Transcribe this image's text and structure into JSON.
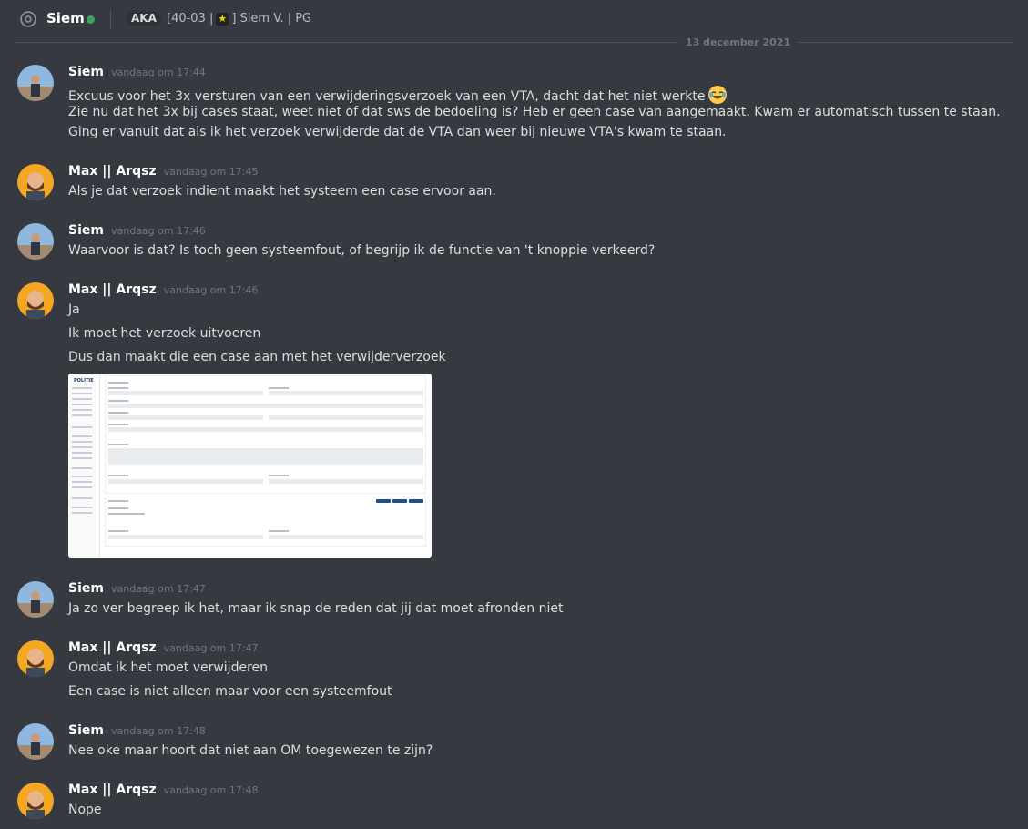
{
  "header": {
    "username": "Siem",
    "aka_label": "AKA",
    "nickname_pre": "[40-03 |",
    "nickname_post": "] Siem V. | PG",
    "star": "★"
  },
  "date_separator": "13 december 2021",
  "messages": [
    {
      "author": "Siem",
      "timestamp": "vandaag om 17:44",
      "lines": [
        "Excuus voor het 3x versturen van een verwijderingsverzoek van een VTA, dacht dat het niet werkte",
        "Zie nu dat het 3x bij cases staat, weet niet of dat sws de bedoeling is? Heb er geen case van aangemaakt. Kwam er automatisch tussen te staan.",
        "Ging er vanuit dat als ik het verzoek verwijderde dat de VTA dan weer bij nieuwe VTA's kwam te staan."
      ]
    },
    {
      "author": "Max || Arqsz",
      "timestamp": "vandaag om 17:45",
      "lines": [
        "Als je dat verzoek indient maakt het systeem een case ervoor aan."
      ]
    },
    {
      "author": "Siem",
      "timestamp": "vandaag om 17:46",
      "lines": [
        "Waarvoor is dat? Is toch geen systeemfout, of begrijp ik de functie van 't knoppie verkeerd?"
      ]
    },
    {
      "author": "Max || Arqsz",
      "timestamp": "vandaag om 17:46",
      "lines": [
        "Ja",
        "Ik moet het verzoek uitvoeren",
        "Dus dan maakt die een case aan met het verwijderverzoek"
      ]
    },
    {
      "author": "Siem",
      "timestamp": "vandaag om 17:47",
      "lines": [
        "Ja zo ver begreep ik het, maar ik snap de reden dat jij dat moet afronden niet"
      ]
    },
    {
      "author": "Max || Arqsz",
      "timestamp": "vandaag om 17:47",
      "lines": [
        "Omdat ik het moet verwijderen",
        "Een case is niet alleen maar voor een systeemfout"
      ]
    },
    {
      "author": "Siem",
      "timestamp": "vandaag om 17:48",
      "lines": [
        "Nee oke maar hoort dat niet aan OM toegewezen te zijn?"
      ]
    },
    {
      "author": "Max || Arqsz",
      "timestamp": "vandaag om 17:48",
      "lines": [
        "Nope"
      ]
    }
  ],
  "attachment": {
    "logo_text": "POLITIE"
  },
  "colors": {
    "background": "#36393f",
    "online": "#3ba55d",
    "text": "#dcddde",
    "muted": "#72767d"
  }
}
